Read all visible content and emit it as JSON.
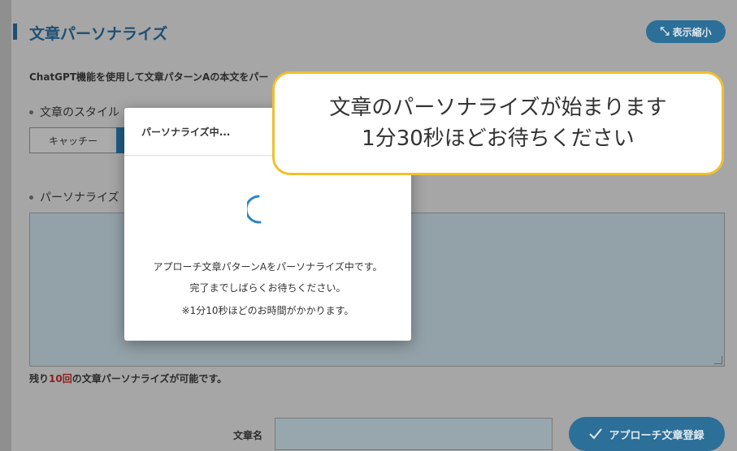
{
  "section": {
    "title": "文章パーソナライズ",
    "collapse_label": "表示縮小",
    "intro": "ChatGPT機能を使用して文章パターンAの本文をパー"
  },
  "labels": {
    "style": "文章のスタイル",
    "personalize": "パーソナライズ"
  },
  "style_options": {
    "first": "キャッチー"
  },
  "remaining": {
    "prefix": "残り",
    "count": "10回",
    "suffix": "の文章パーソナライズが可能です。"
  },
  "footer": {
    "name_label": "文章名",
    "register_label": "アプローチ文章登録"
  },
  "modal": {
    "title": "パーソナライズ中...",
    "line1": "アプローチ文章パターンAをパーソナライズ中です。",
    "line2": "完了までしばらくお待ちください。",
    "line3": "※1分10秒ほどのお時間がかかります。"
  },
  "callout": {
    "line1": "文章のパーソナライズが始まります",
    "line2": "1分30秒ほどお待ちください"
  },
  "colors": {
    "accent": "#1f4f74",
    "button": "#2c6f98",
    "callout_border": "#f0c02c",
    "count": "#8d1f1f"
  },
  "icons": {
    "collapse": "collapse-arrows-icon",
    "register": "checkmark-icon",
    "loading": "spinner-icon"
  }
}
